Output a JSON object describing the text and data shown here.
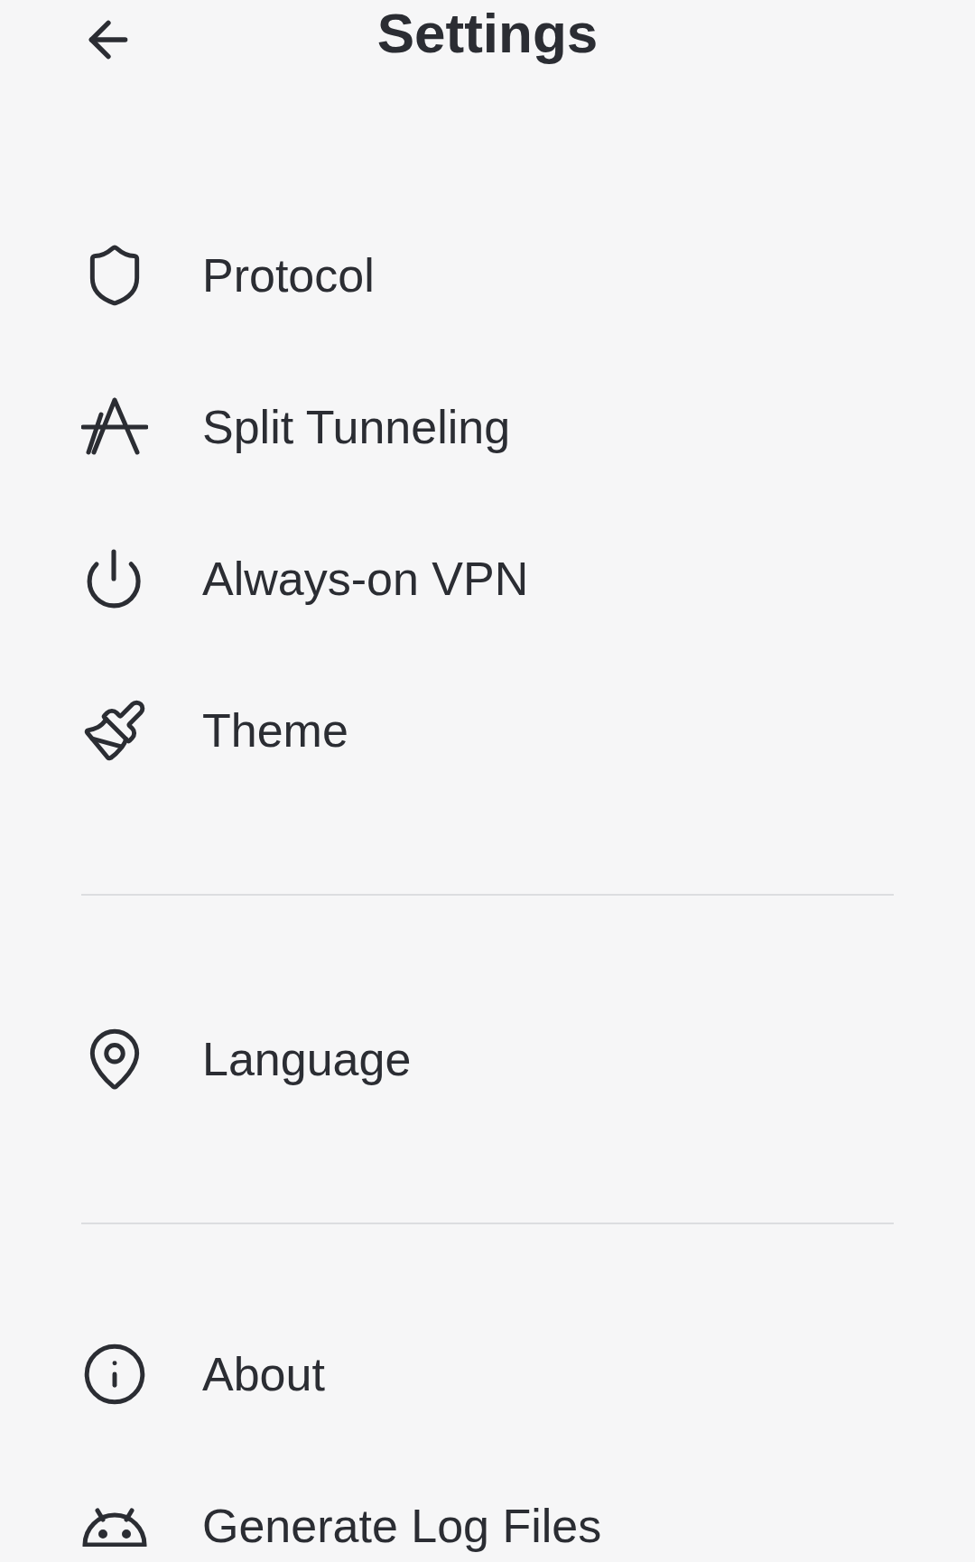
{
  "header": {
    "title": "Settings"
  },
  "groups": [
    {
      "items": [
        {
          "label": "Protocol"
        },
        {
          "label": "Split Tunneling"
        },
        {
          "label": "Always-on VPN"
        },
        {
          "label": "Theme"
        }
      ]
    },
    {
      "items": [
        {
          "label": "Language"
        }
      ]
    },
    {
      "items": [
        {
          "label": "About"
        },
        {
          "label": "Generate Log Files"
        }
      ]
    }
  ]
}
